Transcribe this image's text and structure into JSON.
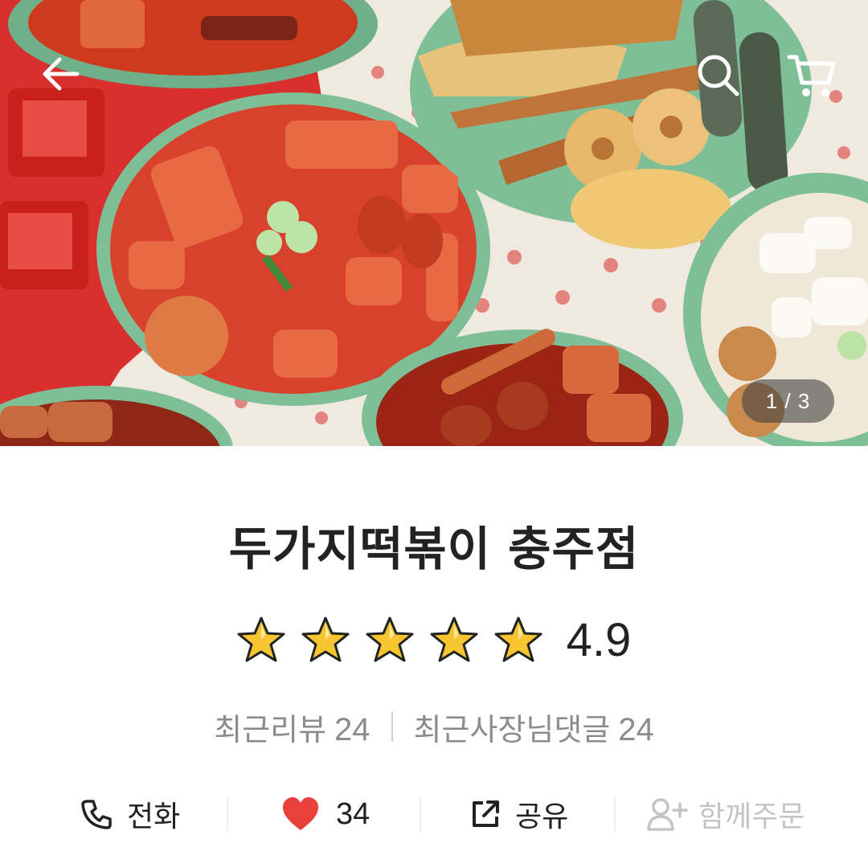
{
  "hero": {
    "pager": "1 / 3",
    "back_icon": "arrow-left-icon",
    "search_icon": "search-icon",
    "cart_icon": "cart-icon"
  },
  "store": {
    "name": "두가지떡볶이 충주점",
    "rating": "4.9",
    "rating_stars": 5,
    "recent_reviews_label": "최근리뷰",
    "recent_reviews_count": "24",
    "owner_replies_label": "최근사장님댓글",
    "owner_replies_count": "24"
  },
  "actions": {
    "call": {
      "label": "전화",
      "icon": "phone-icon"
    },
    "like": {
      "label": "34",
      "icon": "heart-icon",
      "color": "#e8403a"
    },
    "share": {
      "label": "공유",
      "icon": "share-icon"
    },
    "group_order": {
      "label": "함께주문",
      "icon": "add-person-icon",
      "enabled": false
    }
  },
  "colors": {
    "text": "#222222",
    "muted": "#8c8c8c",
    "disabled": "#c4c4c4",
    "star_fill": "#f7c530",
    "heart": "#e8403a"
  }
}
